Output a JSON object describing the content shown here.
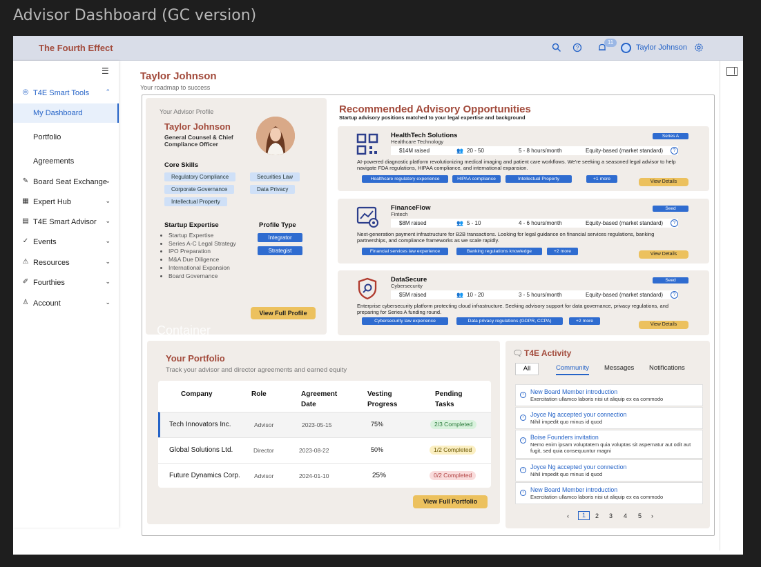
{
  "frame_title": "Advisor Dashboard (GC version)",
  "topbar": {
    "brand": "The Fourth Effect",
    "notifications_count": "11",
    "user_name": "Taylor Johnson"
  },
  "sidebar": {
    "items": [
      {
        "label": "T4E Smart Tools",
        "icon": "smart-tools-icon"
      },
      {
        "label": "My Dashboard"
      },
      {
        "label": "Portfolio"
      },
      {
        "label": "Agreements"
      },
      {
        "label": "Board Seat Exchange",
        "icon": "edit-icon"
      },
      {
        "label": "Expert Hub",
        "icon": "grid-icon"
      },
      {
        "label": "T4E Smart Advisor",
        "icon": "document-icon"
      },
      {
        "label": "Events",
        "icon": "check-circle-icon"
      },
      {
        "label": "Resources",
        "icon": "warning-icon"
      },
      {
        "label": "Fourthies",
        "icon": "brush-icon"
      },
      {
        "label": "Account",
        "icon": "person-icon"
      }
    ]
  },
  "page": {
    "title": "Taylor Johnson",
    "subtitle": "Your roadmap to success"
  },
  "profile": {
    "caption": "Your Advisor Profile",
    "name": "Taylor Johnson",
    "role": "General Counsel & Chief Compliance Officer",
    "core_skills_heading": "Core Skills",
    "skills": [
      "Regulatory Compliance",
      "Securities Law",
      "Corporate Governance",
      "Data Privacy",
      "Intellectual Property"
    ],
    "startup_expertise_heading": "Startup Expertise",
    "expertise": [
      "Startup Expertise",
      "Series A-C Legal Strategy",
      "IPO Preparation",
      "M&A Due Diligence",
      "International Expansion",
      "Board Governance"
    ],
    "profile_type_heading": "Profile Type",
    "profile_types": [
      "Integrator",
      "Strategist"
    ],
    "view_button": "View Full Profile",
    "ghost_label": "Container"
  },
  "opportunities": {
    "title": "Recommended Advisory Opportunities",
    "subtitle": "Startup advisory positions matched to your legal expertise and background",
    "cards": [
      {
        "name": "HealthTech Solutions",
        "industry": "Healthcare Technology",
        "stage": "Series A",
        "raised": "$14M raised",
        "team": "20 - 50",
        "hours": "5 - 8 hours/month",
        "equity": "Equity-based (market standard)",
        "description": "AI-powered diagnostic platform revolutionizing medical imaging and patient care workflows. We're seeking a seasoned legal advisor to help navigate FDA regulations, HIPAA compliance, and international expansion.",
        "tags": [
          "Healthcare regulatory experience",
          "HIPAA compliance",
          "Intellectual Property",
          "+1 more"
        ],
        "view": "View Details"
      },
      {
        "name": "FinanceFlow",
        "industry": "Fintech",
        "stage": "Seed",
        "raised": "$8M raised",
        "team": "5 - 10",
        "hours": "4 - 6 hours/month",
        "equity": "Equity-based (market standard)",
        "description": "Next-generation payment infrastructure for B2B transactions. Looking for legal guidance on financial services regulations, banking partnerships, and compliance frameworks as we scale rapidly.",
        "tags": [
          "Financial services law experience",
          "Banking regulations knowledge",
          "+2 more"
        ],
        "view": "View Details"
      },
      {
        "name": "DataSecure",
        "industry": "Cybersecurity",
        "stage": "Seed",
        "raised": "$5M raised",
        "team": "10 - 20",
        "hours": "3 - 5 hours/month",
        "equity": "Equity-based (market standard)",
        "description": "Enterprise cybersecurity platform protecting cloud infrastructure. Seeking advisory support for data governance, privacy regulations, and preparing for Series A funding round.",
        "tags": [
          "Cybersecurity law experience",
          "Data privacy regulations (GDPR, CCPA)",
          "+2 more"
        ],
        "view": "View Details"
      }
    ]
  },
  "portfolio": {
    "title": "Your Portfolio",
    "subtitle": "Track your advisor and director agreements and earned equity",
    "headers": [
      "Company",
      "Role",
      "Agreement Date",
      "Vesting Progress",
      "Pending Tasks"
    ],
    "rows": [
      {
        "company": "Tech Innovators Inc.",
        "role": "Advisor",
        "date": "2023-05-15",
        "vesting": "75%",
        "tasks": "2/3 Completed",
        "status_color": "#d9f2dd",
        "status_text": "#2a7a3b"
      },
      {
        "company": "Global Solutions Ltd.",
        "role": "Director",
        "date": "2023-08-22",
        "vesting": "50%",
        "tasks": "1/2 Completed",
        "status_color": "#fbefc2",
        "status_text": "#6a5600"
      },
      {
        "company": "Future Dynamics Corp.",
        "role": "Advisor",
        "date": "2024-01-10",
        "vesting": "25%",
        "tasks": "0/2 Completed",
        "status_color": "#f9dcdc",
        "status_text": "#b04040"
      }
    ],
    "view_button": "View Full Portfolio"
  },
  "activity": {
    "title": "T4E Activity",
    "tabs": [
      "All",
      "Community",
      "Messages",
      "Notifications"
    ],
    "items": [
      {
        "title": "New Board Member introduction",
        "desc": "Exercitation ullamco laboris nisi ut aliquip ex ea commodo"
      },
      {
        "title": "Joyce Ng accepted your connection",
        "desc": "Nihil impedit quo minus id quod"
      },
      {
        "title": "Boise Founders invitation",
        "desc": "Nemo enim ipsam voluptatem quia voluptas sit aspernatur aut odit aut fugit, sed quia consequuntur magni"
      },
      {
        "title": "Joyce Ng accepted your connection",
        "desc": "Nihil impedit quo minus id quod"
      },
      {
        "title": "New Board Member introduction",
        "desc": "Exercitation ullamco laboris nisi ut aliquip ex ea commodo"
      }
    ],
    "pages": [
      "1",
      "2",
      "3",
      "4",
      "5"
    ]
  },
  "colors": {
    "accent": "#2563c7",
    "brand": "#a24a3b",
    "button_yellow": "#ecc15e",
    "card_bg": "#f1ede9"
  }
}
